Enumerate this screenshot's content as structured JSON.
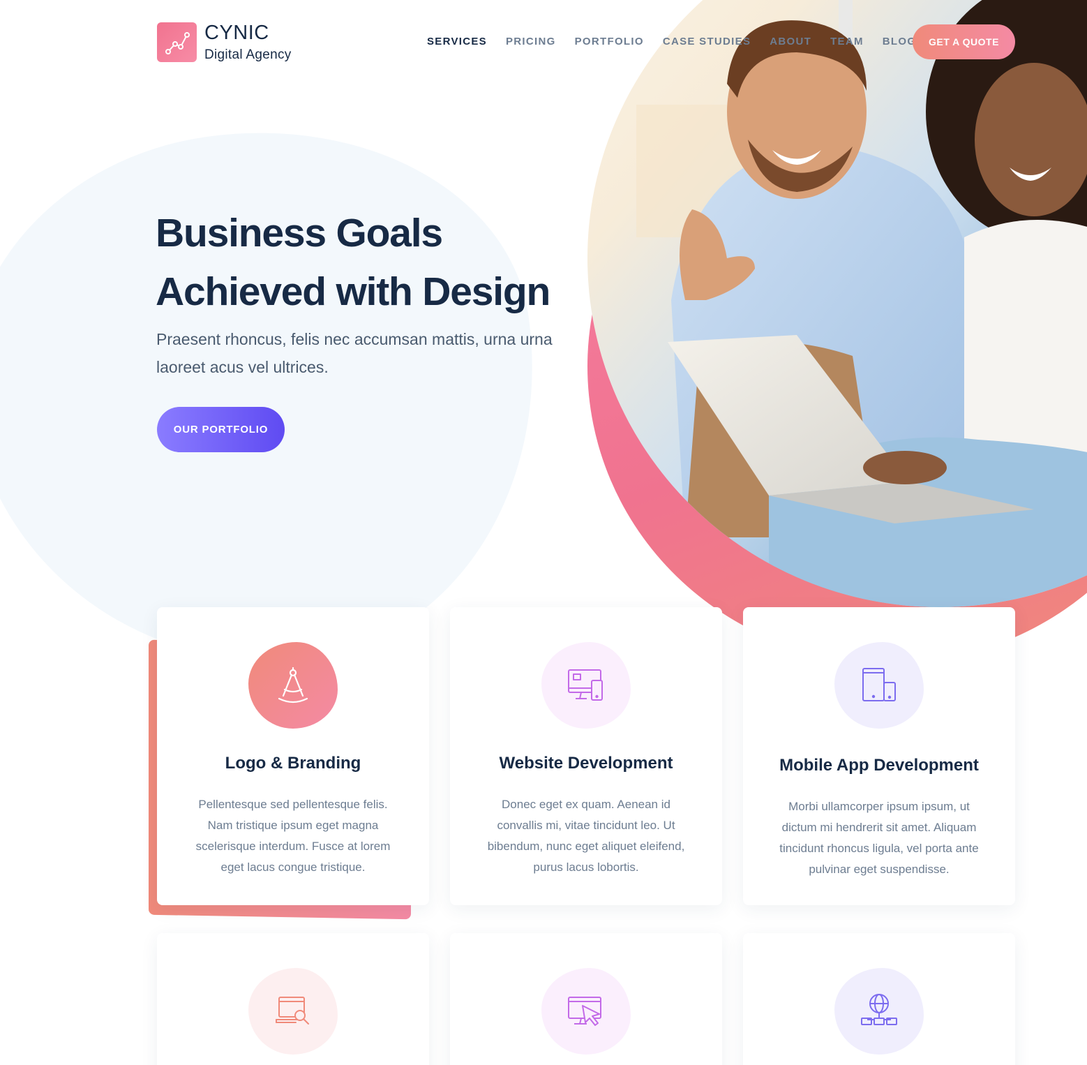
{
  "brand": {
    "name": "CYNIC",
    "tagline": "Digital Agency"
  },
  "nav": {
    "items": [
      {
        "label": "SERVICES",
        "active": true
      },
      {
        "label": "PRICING",
        "active": false
      },
      {
        "label": "PORTFOLIO",
        "active": false
      },
      {
        "label": "CASE STUDIES",
        "active": false
      },
      {
        "label": "ABOUT",
        "active": false
      },
      {
        "label": "TEAM",
        "active": false
      },
      {
        "label": "BLOG",
        "active": false
      }
    ],
    "cta_label": "GET A QUOTE"
  },
  "hero": {
    "title_line1": "Business Goals",
    "title_line2": "Achieved with Design",
    "subtitle": "Praesent rhoncus, felis nec accumsan mattis, urna urna laoreet acus vel ultrices.",
    "button_label": "OUR PORTFOLIO"
  },
  "services": [
    {
      "title": "Logo & Branding",
      "text": "Pellentesque sed pellentesque felis. Nam tristique ipsum eget magna scelerisque interdum. Fusce at lorem eget lacus congue tristique.",
      "icon": "compass-icon"
    },
    {
      "title": "Website Development",
      "text": "Donec eget ex quam. Aenean id convallis mi, vitae tincidunt leo. Ut bibendum, nunc eget aliquet eleifend, purus lacus lobortis.",
      "icon": "responsive-devices-icon"
    },
    {
      "title": "Mobile App Development",
      "text": "Morbi ullamcorper ipsum ipsum, ut dictum mi hendrerit sit amet. Aliquam tincidunt rhoncus ligula, vel porta ante pulvinar eget suspendisse.",
      "icon": "mobile-tablet-icon"
    },
    {
      "icon": "web-search-icon"
    },
    {
      "icon": "screen-cursor-icon"
    },
    {
      "icon": "globe-network-icon"
    }
  ],
  "colors": {
    "navy": "#172a45",
    "muted": "#6d7d91",
    "coral_pink": "#f08a7a",
    "pink": "#f48aa4",
    "violet": "#5f4bf2",
    "lavender": "#8a7cff"
  }
}
